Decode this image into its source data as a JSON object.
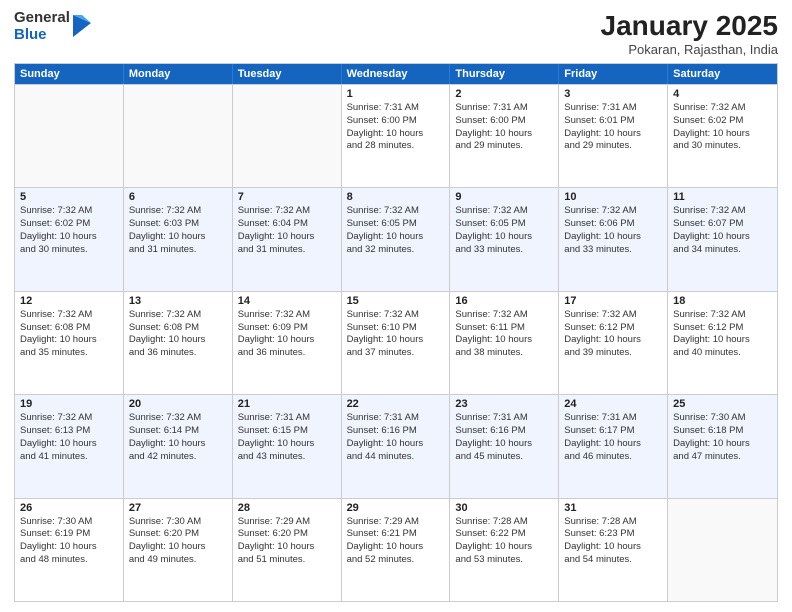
{
  "logo": {
    "general": "General",
    "blue": "Blue"
  },
  "header": {
    "title": "January 2025",
    "subtitle": "Pokaran, Rajasthan, India"
  },
  "weekdays": [
    "Sunday",
    "Monday",
    "Tuesday",
    "Wednesday",
    "Thursday",
    "Friday",
    "Saturday"
  ],
  "rows": [
    {
      "alt": false,
      "cells": [
        {
          "day": "",
          "lines": []
        },
        {
          "day": "",
          "lines": []
        },
        {
          "day": "",
          "lines": []
        },
        {
          "day": "1",
          "lines": [
            "Sunrise: 7:31 AM",
            "Sunset: 6:00 PM",
            "Daylight: 10 hours",
            "and 28 minutes."
          ]
        },
        {
          "day": "2",
          "lines": [
            "Sunrise: 7:31 AM",
            "Sunset: 6:00 PM",
            "Daylight: 10 hours",
            "and 29 minutes."
          ]
        },
        {
          "day": "3",
          "lines": [
            "Sunrise: 7:31 AM",
            "Sunset: 6:01 PM",
            "Daylight: 10 hours",
            "and 29 minutes."
          ]
        },
        {
          "day": "4",
          "lines": [
            "Sunrise: 7:32 AM",
            "Sunset: 6:02 PM",
            "Daylight: 10 hours",
            "and 30 minutes."
          ]
        }
      ]
    },
    {
      "alt": true,
      "cells": [
        {
          "day": "5",
          "lines": [
            "Sunrise: 7:32 AM",
            "Sunset: 6:02 PM",
            "Daylight: 10 hours",
            "and 30 minutes."
          ]
        },
        {
          "day": "6",
          "lines": [
            "Sunrise: 7:32 AM",
            "Sunset: 6:03 PM",
            "Daylight: 10 hours",
            "and 31 minutes."
          ]
        },
        {
          "day": "7",
          "lines": [
            "Sunrise: 7:32 AM",
            "Sunset: 6:04 PM",
            "Daylight: 10 hours",
            "and 31 minutes."
          ]
        },
        {
          "day": "8",
          "lines": [
            "Sunrise: 7:32 AM",
            "Sunset: 6:05 PM",
            "Daylight: 10 hours",
            "and 32 minutes."
          ]
        },
        {
          "day": "9",
          "lines": [
            "Sunrise: 7:32 AM",
            "Sunset: 6:05 PM",
            "Daylight: 10 hours",
            "and 33 minutes."
          ]
        },
        {
          "day": "10",
          "lines": [
            "Sunrise: 7:32 AM",
            "Sunset: 6:06 PM",
            "Daylight: 10 hours",
            "and 33 minutes."
          ]
        },
        {
          "day": "11",
          "lines": [
            "Sunrise: 7:32 AM",
            "Sunset: 6:07 PM",
            "Daylight: 10 hours",
            "and 34 minutes."
          ]
        }
      ]
    },
    {
      "alt": false,
      "cells": [
        {
          "day": "12",
          "lines": [
            "Sunrise: 7:32 AM",
            "Sunset: 6:08 PM",
            "Daylight: 10 hours",
            "and 35 minutes."
          ]
        },
        {
          "day": "13",
          "lines": [
            "Sunrise: 7:32 AM",
            "Sunset: 6:08 PM",
            "Daylight: 10 hours",
            "and 36 minutes."
          ]
        },
        {
          "day": "14",
          "lines": [
            "Sunrise: 7:32 AM",
            "Sunset: 6:09 PM",
            "Daylight: 10 hours",
            "and 36 minutes."
          ]
        },
        {
          "day": "15",
          "lines": [
            "Sunrise: 7:32 AM",
            "Sunset: 6:10 PM",
            "Daylight: 10 hours",
            "and 37 minutes."
          ]
        },
        {
          "day": "16",
          "lines": [
            "Sunrise: 7:32 AM",
            "Sunset: 6:11 PM",
            "Daylight: 10 hours",
            "and 38 minutes."
          ]
        },
        {
          "day": "17",
          "lines": [
            "Sunrise: 7:32 AM",
            "Sunset: 6:12 PM",
            "Daylight: 10 hours",
            "and 39 minutes."
          ]
        },
        {
          "day": "18",
          "lines": [
            "Sunrise: 7:32 AM",
            "Sunset: 6:12 PM",
            "Daylight: 10 hours",
            "and 40 minutes."
          ]
        }
      ]
    },
    {
      "alt": true,
      "cells": [
        {
          "day": "19",
          "lines": [
            "Sunrise: 7:32 AM",
            "Sunset: 6:13 PM",
            "Daylight: 10 hours",
            "and 41 minutes."
          ]
        },
        {
          "day": "20",
          "lines": [
            "Sunrise: 7:32 AM",
            "Sunset: 6:14 PM",
            "Daylight: 10 hours",
            "and 42 minutes."
          ]
        },
        {
          "day": "21",
          "lines": [
            "Sunrise: 7:31 AM",
            "Sunset: 6:15 PM",
            "Daylight: 10 hours",
            "and 43 minutes."
          ]
        },
        {
          "day": "22",
          "lines": [
            "Sunrise: 7:31 AM",
            "Sunset: 6:16 PM",
            "Daylight: 10 hours",
            "and 44 minutes."
          ]
        },
        {
          "day": "23",
          "lines": [
            "Sunrise: 7:31 AM",
            "Sunset: 6:16 PM",
            "Daylight: 10 hours",
            "and 45 minutes."
          ]
        },
        {
          "day": "24",
          "lines": [
            "Sunrise: 7:31 AM",
            "Sunset: 6:17 PM",
            "Daylight: 10 hours",
            "and 46 minutes."
          ]
        },
        {
          "day": "25",
          "lines": [
            "Sunrise: 7:30 AM",
            "Sunset: 6:18 PM",
            "Daylight: 10 hours",
            "and 47 minutes."
          ]
        }
      ]
    },
    {
      "alt": false,
      "cells": [
        {
          "day": "26",
          "lines": [
            "Sunrise: 7:30 AM",
            "Sunset: 6:19 PM",
            "Daylight: 10 hours",
            "and 48 minutes."
          ]
        },
        {
          "day": "27",
          "lines": [
            "Sunrise: 7:30 AM",
            "Sunset: 6:20 PM",
            "Daylight: 10 hours",
            "and 49 minutes."
          ]
        },
        {
          "day": "28",
          "lines": [
            "Sunrise: 7:29 AM",
            "Sunset: 6:20 PM",
            "Daylight: 10 hours",
            "and 51 minutes."
          ]
        },
        {
          "day": "29",
          "lines": [
            "Sunrise: 7:29 AM",
            "Sunset: 6:21 PM",
            "Daylight: 10 hours",
            "and 52 minutes."
          ]
        },
        {
          "day": "30",
          "lines": [
            "Sunrise: 7:28 AM",
            "Sunset: 6:22 PM",
            "Daylight: 10 hours",
            "and 53 minutes."
          ]
        },
        {
          "day": "31",
          "lines": [
            "Sunrise: 7:28 AM",
            "Sunset: 6:23 PM",
            "Daylight: 10 hours",
            "and 54 minutes."
          ]
        },
        {
          "day": "",
          "lines": []
        }
      ]
    }
  ]
}
